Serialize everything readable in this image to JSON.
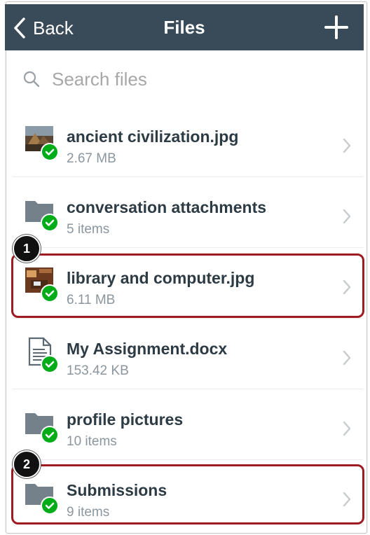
{
  "navbar": {
    "back_label": "Back",
    "title": "Files",
    "add_icon": "plus-icon",
    "bg_color": "#394b58"
  },
  "search": {
    "placeholder": "Search files",
    "icon": "search-icon"
  },
  "files": [
    {
      "name": "ancient civilization.jpg",
      "meta": "2.67 MB",
      "kind": "image",
      "synced": true
    },
    {
      "name": "conversation attachments",
      "meta": "5 items",
      "kind": "folder",
      "synced": true
    },
    {
      "name": "library and computer.jpg",
      "meta": "6.11 MB",
      "kind": "image",
      "synced": true
    },
    {
      "name": "My Assignment.docx",
      "meta": "153.42 KB",
      "kind": "document",
      "synced": true
    },
    {
      "name": "profile pictures",
      "meta": "10 items",
      "kind": "folder",
      "synced": true
    },
    {
      "name": "Submissions",
      "meta": "9 items",
      "kind": "folder",
      "synced": true
    }
  ],
  "callouts": [
    {
      "number": "1",
      "target": "library and computer.jpg"
    },
    {
      "number": "2",
      "target": "Submissions"
    }
  ],
  "colors": {
    "highlight_border": "#9e1b22",
    "sync_check": "#00ac18",
    "name_text": "#2d3b45",
    "meta_text": "#8b969e"
  }
}
